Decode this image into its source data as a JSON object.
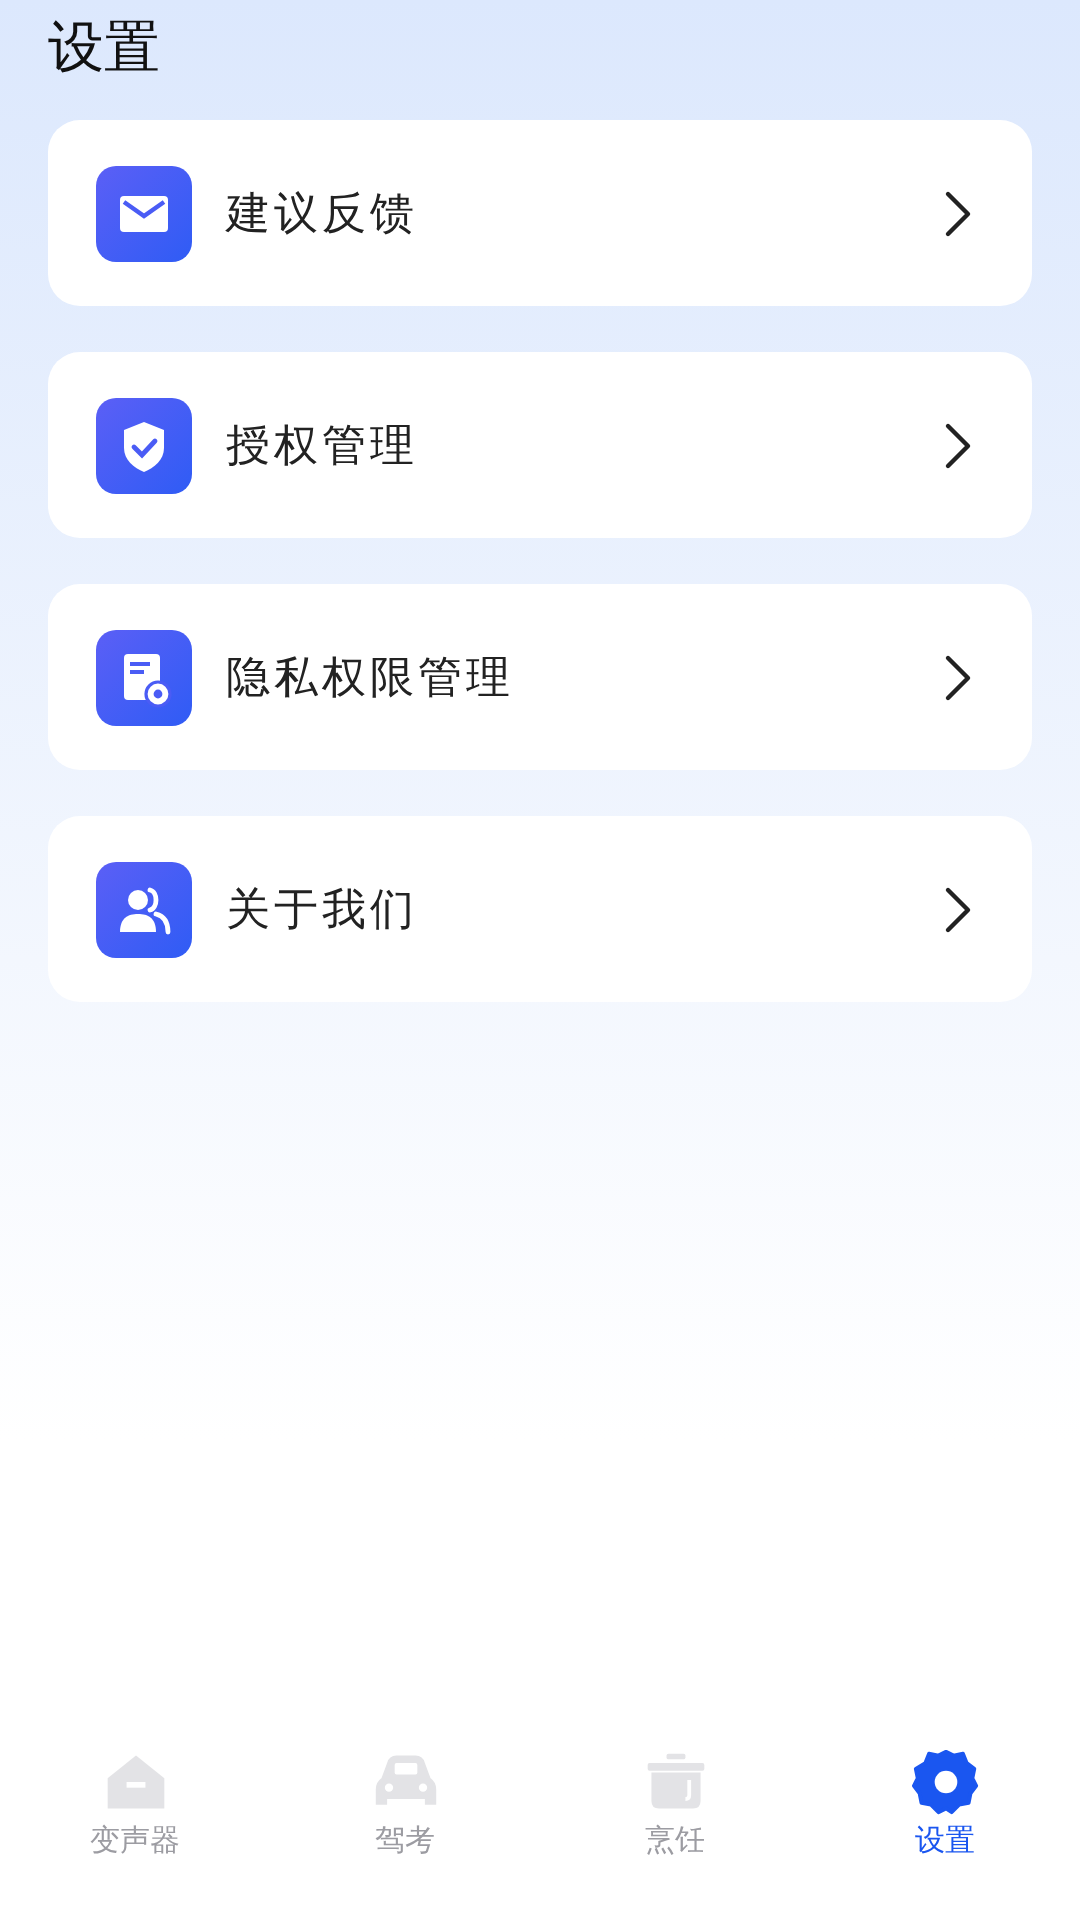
{
  "title": "设置",
  "items": [
    {
      "label": "建议反馈"
    },
    {
      "label": "授权管理"
    },
    {
      "label": "隐私权限管理"
    },
    {
      "label": "关于我们"
    }
  ],
  "tabs": [
    {
      "label": "变声器",
      "selected": false
    },
    {
      "label": "驾考",
      "selected": false
    },
    {
      "label": "烹饪",
      "selected": false
    },
    {
      "label": "设置",
      "selected": true
    }
  ]
}
